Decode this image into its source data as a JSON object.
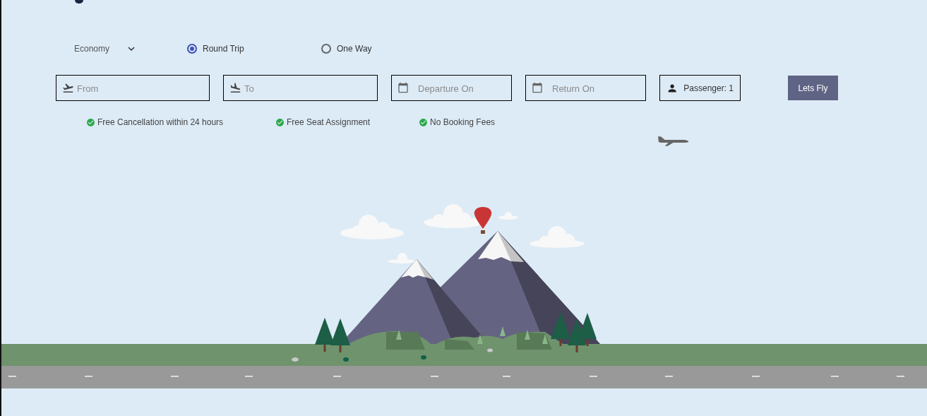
{
  "cabin": {
    "value": "Economy"
  },
  "trip_type": [
    {
      "label": "Round Trip",
      "selected": true
    },
    {
      "label": "One Way",
      "selected": false
    }
  ],
  "fields": [
    {
      "kind": "takeoff",
      "placeholder": "From"
    },
    {
      "kind": "landing",
      "placeholder": "To"
    },
    {
      "kind": "date",
      "placeholder": "Departure On"
    },
    {
      "kind": "date",
      "placeholder": "Return On"
    },
    {
      "kind": "passenger",
      "value": "Passenger: 1"
    }
  ],
  "search_button": "Lets Fly",
  "features": [
    "Free Cancellation within 24 hours",
    "Free Seat Assignment",
    "No Booking Fees"
  ]
}
